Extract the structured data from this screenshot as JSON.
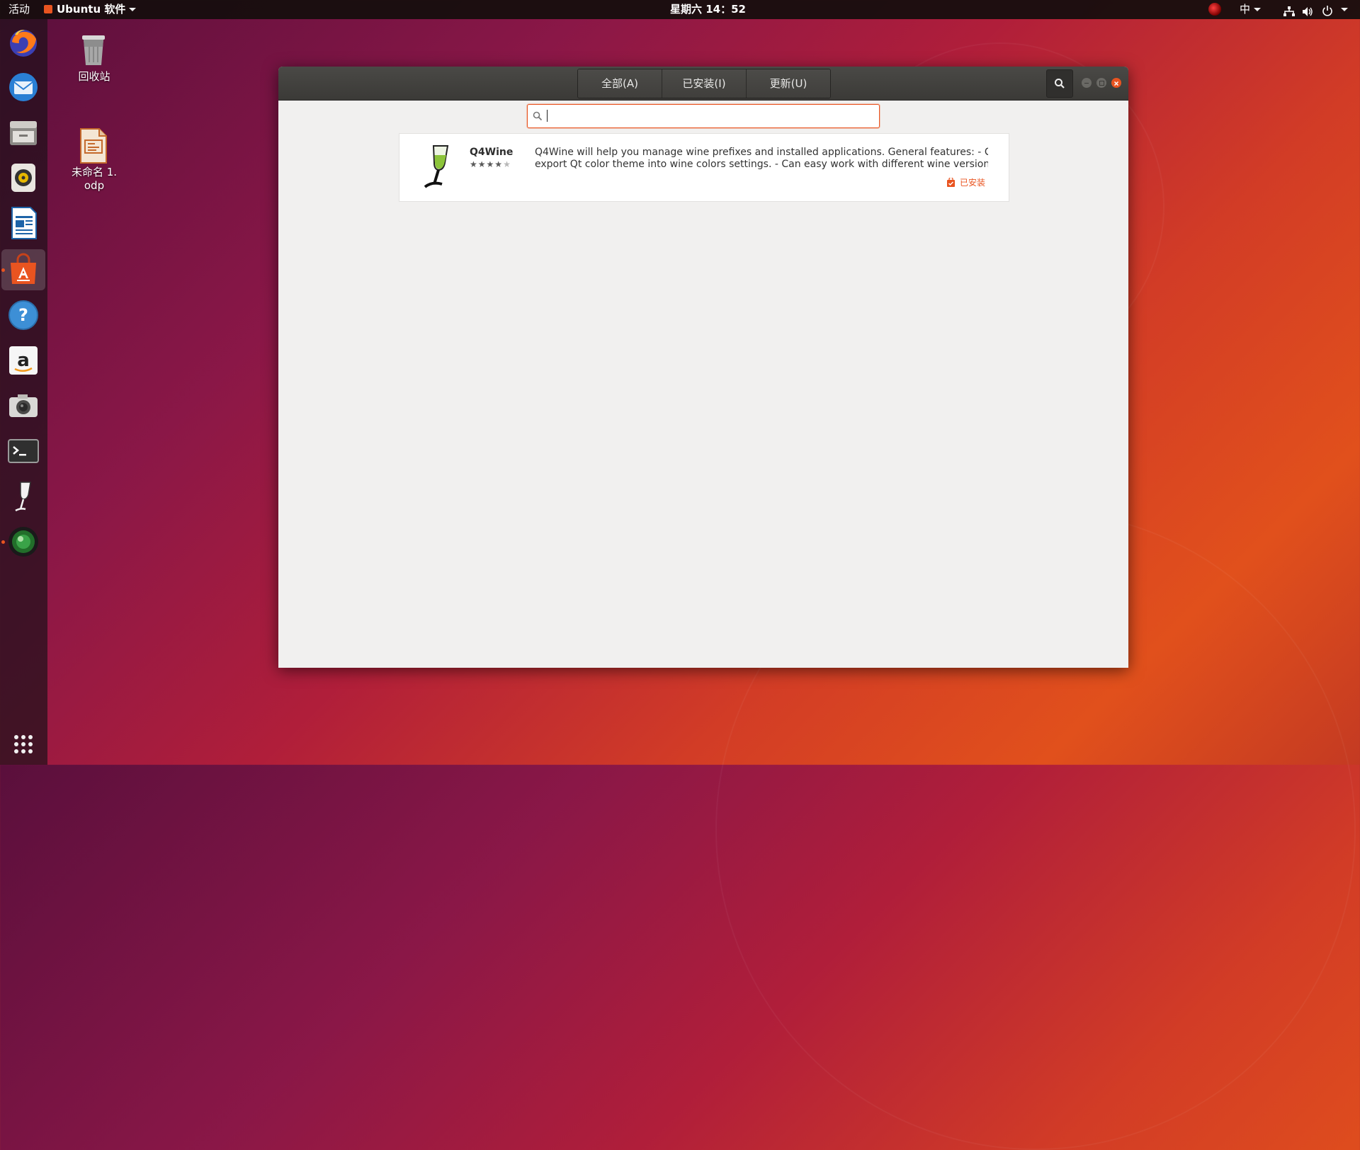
{
  "topbar": {
    "activities": "活动",
    "app_menu": "Ubuntu 软件",
    "clock": "星期六 14：52",
    "input_method": "中"
  },
  "desktop": {
    "trash_label": "回收站",
    "file_label": "未命名 1.\nodp"
  },
  "dock": {
    "items": [
      "firefox-icon",
      "thunderbird-icon",
      "files-icon",
      "rhythmbox-icon",
      "writer-icon",
      "software-icon",
      "help-icon",
      "amazon-icon",
      "camera-icon",
      "terminal-icon",
      "wine-icon",
      "webcam-icon"
    ],
    "active": "software-icon"
  },
  "window": {
    "tabs": [
      {
        "label": "全部(A)",
        "active": false
      },
      {
        "label": "已安装(I)",
        "active": false
      },
      {
        "label": "更新(U)",
        "active": false
      }
    ],
    "search": {
      "value": "",
      "placeholder": ""
    },
    "results": [
      {
        "name": "Q4Wine",
        "rating": 4,
        "rating_max": 5,
        "description_line1": "Q4Wine will help you manage wine prefixes and installed applications.  General features:  - Can",
        "description_line2": "export Qt color theme into wine colors settings.  - Can easy work with different wine versions …",
        "status": "已安装"
      }
    ]
  },
  "colors": {
    "accent": "#e95420",
    "headerbar": "#3e3d3a",
    "window_bg": "#f1f0ef"
  }
}
